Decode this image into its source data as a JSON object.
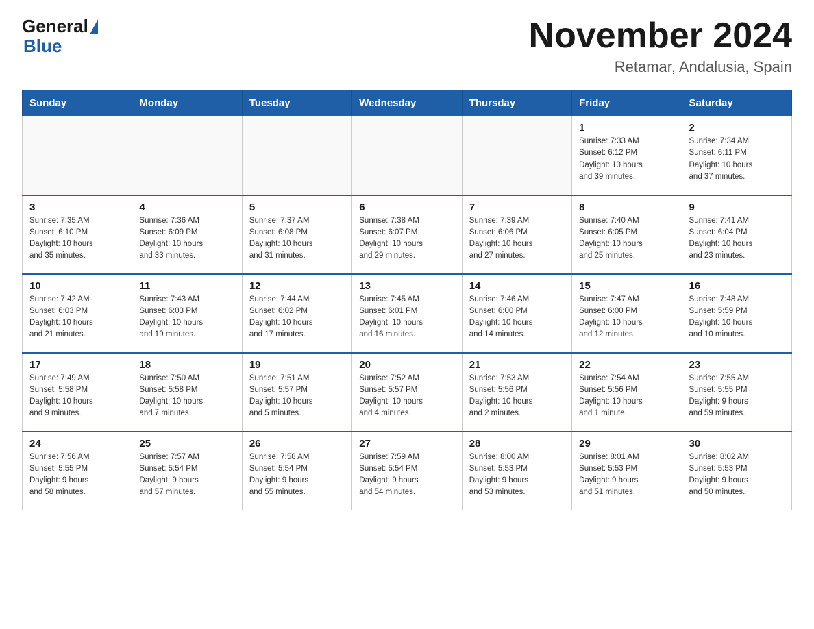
{
  "logo": {
    "general": "General",
    "blue": "Blue"
  },
  "title": "November 2024",
  "subtitle": "Retamar, Andalusia, Spain",
  "weekdays": [
    "Sunday",
    "Monday",
    "Tuesday",
    "Wednesday",
    "Thursday",
    "Friday",
    "Saturday"
  ],
  "weeks": [
    [
      {
        "day": "",
        "info": ""
      },
      {
        "day": "",
        "info": ""
      },
      {
        "day": "",
        "info": ""
      },
      {
        "day": "",
        "info": ""
      },
      {
        "day": "",
        "info": ""
      },
      {
        "day": "1",
        "info": "Sunrise: 7:33 AM\nSunset: 6:12 PM\nDaylight: 10 hours\nand 39 minutes."
      },
      {
        "day": "2",
        "info": "Sunrise: 7:34 AM\nSunset: 6:11 PM\nDaylight: 10 hours\nand 37 minutes."
      }
    ],
    [
      {
        "day": "3",
        "info": "Sunrise: 7:35 AM\nSunset: 6:10 PM\nDaylight: 10 hours\nand 35 minutes."
      },
      {
        "day": "4",
        "info": "Sunrise: 7:36 AM\nSunset: 6:09 PM\nDaylight: 10 hours\nand 33 minutes."
      },
      {
        "day": "5",
        "info": "Sunrise: 7:37 AM\nSunset: 6:08 PM\nDaylight: 10 hours\nand 31 minutes."
      },
      {
        "day": "6",
        "info": "Sunrise: 7:38 AM\nSunset: 6:07 PM\nDaylight: 10 hours\nand 29 minutes."
      },
      {
        "day": "7",
        "info": "Sunrise: 7:39 AM\nSunset: 6:06 PM\nDaylight: 10 hours\nand 27 minutes."
      },
      {
        "day": "8",
        "info": "Sunrise: 7:40 AM\nSunset: 6:05 PM\nDaylight: 10 hours\nand 25 minutes."
      },
      {
        "day": "9",
        "info": "Sunrise: 7:41 AM\nSunset: 6:04 PM\nDaylight: 10 hours\nand 23 minutes."
      }
    ],
    [
      {
        "day": "10",
        "info": "Sunrise: 7:42 AM\nSunset: 6:03 PM\nDaylight: 10 hours\nand 21 minutes."
      },
      {
        "day": "11",
        "info": "Sunrise: 7:43 AM\nSunset: 6:03 PM\nDaylight: 10 hours\nand 19 minutes."
      },
      {
        "day": "12",
        "info": "Sunrise: 7:44 AM\nSunset: 6:02 PM\nDaylight: 10 hours\nand 17 minutes."
      },
      {
        "day": "13",
        "info": "Sunrise: 7:45 AM\nSunset: 6:01 PM\nDaylight: 10 hours\nand 16 minutes."
      },
      {
        "day": "14",
        "info": "Sunrise: 7:46 AM\nSunset: 6:00 PM\nDaylight: 10 hours\nand 14 minutes."
      },
      {
        "day": "15",
        "info": "Sunrise: 7:47 AM\nSunset: 6:00 PM\nDaylight: 10 hours\nand 12 minutes."
      },
      {
        "day": "16",
        "info": "Sunrise: 7:48 AM\nSunset: 5:59 PM\nDaylight: 10 hours\nand 10 minutes."
      }
    ],
    [
      {
        "day": "17",
        "info": "Sunrise: 7:49 AM\nSunset: 5:58 PM\nDaylight: 10 hours\nand 9 minutes."
      },
      {
        "day": "18",
        "info": "Sunrise: 7:50 AM\nSunset: 5:58 PM\nDaylight: 10 hours\nand 7 minutes."
      },
      {
        "day": "19",
        "info": "Sunrise: 7:51 AM\nSunset: 5:57 PM\nDaylight: 10 hours\nand 5 minutes."
      },
      {
        "day": "20",
        "info": "Sunrise: 7:52 AM\nSunset: 5:57 PM\nDaylight: 10 hours\nand 4 minutes."
      },
      {
        "day": "21",
        "info": "Sunrise: 7:53 AM\nSunset: 5:56 PM\nDaylight: 10 hours\nand 2 minutes."
      },
      {
        "day": "22",
        "info": "Sunrise: 7:54 AM\nSunset: 5:56 PM\nDaylight: 10 hours\nand 1 minute."
      },
      {
        "day": "23",
        "info": "Sunrise: 7:55 AM\nSunset: 5:55 PM\nDaylight: 9 hours\nand 59 minutes."
      }
    ],
    [
      {
        "day": "24",
        "info": "Sunrise: 7:56 AM\nSunset: 5:55 PM\nDaylight: 9 hours\nand 58 minutes."
      },
      {
        "day": "25",
        "info": "Sunrise: 7:57 AM\nSunset: 5:54 PM\nDaylight: 9 hours\nand 57 minutes."
      },
      {
        "day": "26",
        "info": "Sunrise: 7:58 AM\nSunset: 5:54 PM\nDaylight: 9 hours\nand 55 minutes."
      },
      {
        "day": "27",
        "info": "Sunrise: 7:59 AM\nSunset: 5:54 PM\nDaylight: 9 hours\nand 54 minutes."
      },
      {
        "day": "28",
        "info": "Sunrise: 8:00 AM\nSunset: 5:53 PM\nDaylight: 9 hours\nand 53 minutes."
      },
      {
        "day": "29",
        "info": "Sunrise: 8:01 AM\nSunset: 5:53 PM\nDaylight: 9 hours\nand 51 minutes."
      },
      {
        "day": "30",
        "info": "Sunrise: 8:02 AM\nSunset: 5:53 PM\nDaylight: 9 hours\nand 50 minutes."
      }
    ]
  ]
}
